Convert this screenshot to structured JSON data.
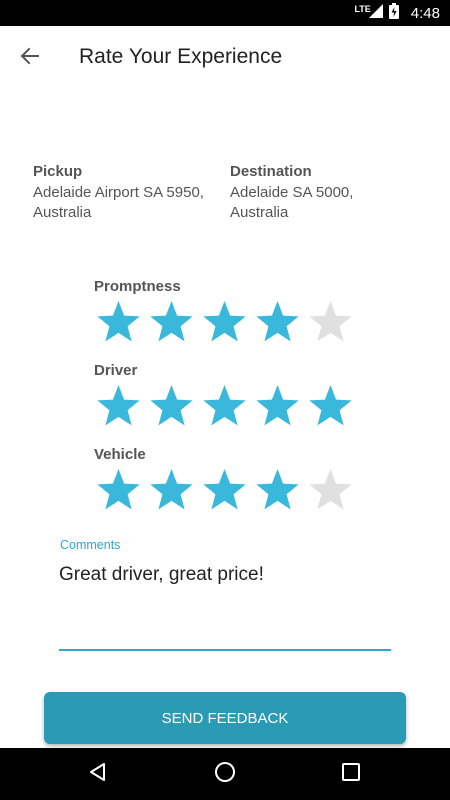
{
  "status_bar": {
    "network": "LTE",
    "time": "4:48"
  },
  "header": {
    "title": "Rate Your Experience",
    "back_icon": "arrow-left-icon"
  },
  "trip": {
    "pickup": {
      "label": "Pickup",
      "address_line1": "Adelaide Airport SA 5950,",
      "address_line2": "Australia"
    },
    "destination": {
      "label": "Destination",
      "address_line1": "Adelaide SA 5000,",
      "address_line2": "Australia"
    }
  },
  "ratings": [
    {
      "label": "Promptness",
      "value": 4,
      "max": 5
    },
    {
      "label": "Driver",
      "value": 5,
      "max": 5
    },
    {
      "label": "Vehicle",
      "value": 4,
      "max": 5
    }
  ],
  "comments": {
    "label": "Comments",
    "value": "Great driver, great price!"
  },
  "actions": {
    "send_label": "SEND FEEDBACK"
  },
  "colors": {
    "star_active": "#3ab8dc",
    "star_inactive": "#e0e0e0",
    "accent": "#2aa9d2",
    "button": "#2b9bb5"
  },
  "nav": {
    "icons": [
      "back-triangle-icon",
      "home-circle-icon",
      "recents-square-icon"
    ]
  }
}
